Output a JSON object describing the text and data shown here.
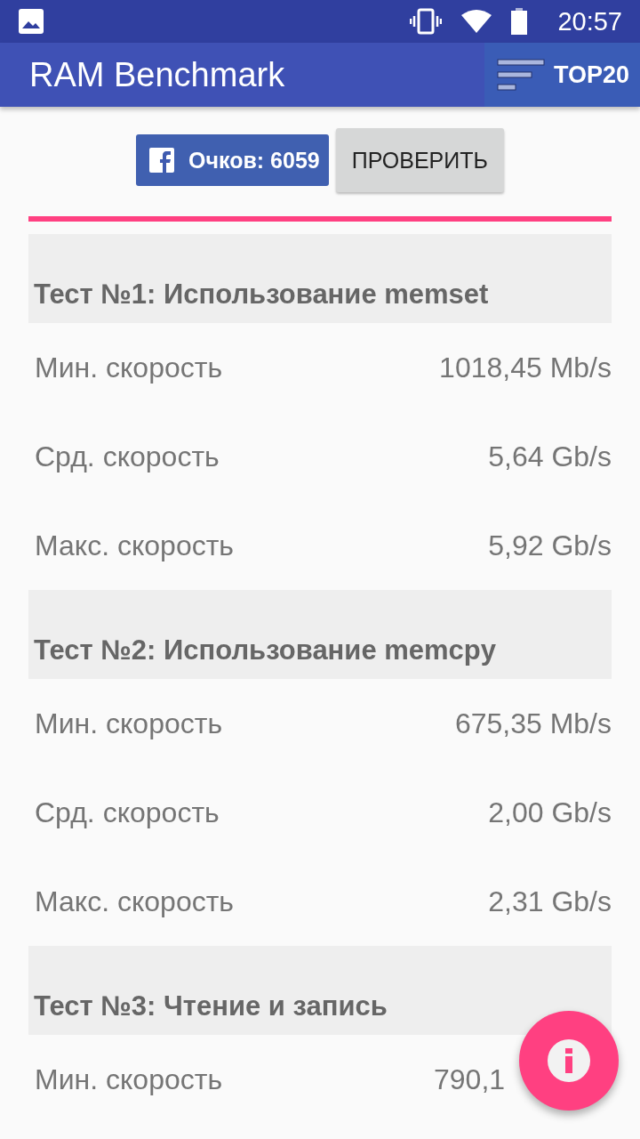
{
  "status_bar": {
    "time": "20:57"
  },
  "app_bar": {
    "title": "RAM Benchmark",
    "action": "TOP20"
  },
  "score_button": "Очков: 6059",
  "check_button": "ПРОВЕРИТЬ",
  "tests": [
    {
      "title": "Тест №1: Использование memset",
      "rows": [
        {
          "label": "Мин. скорость",
          "value": "1018,45 Mb/s"
        },
        {
          "label": "Срд. скорость",
          "value": "5,64 Gb/s"
        },
        {
          "label": "Макс. скорость",
          "value": "5,92 Gb/s"
        }
      ]
    },
    {
      "title": "Тест №2: Использование memcpy",
      "rows": [
        {
          "label": "Мин. скорость",
          "value": "675,35 Mb/s"
        },
        {
          "label": "Срд. скорость",
          "value": "2,00 Gb/s"
        },
        {
          "label": "Макс. скорость",
          "value": "2,31 Gb/s"
        }
      ]
    },
    {
      "title": "Тест №3: Чтение и запись",
      "rows": [
        {
          "label": "Мин. скорость",
          "value": "790,1"
        }
      ]
    }
  ]
}
